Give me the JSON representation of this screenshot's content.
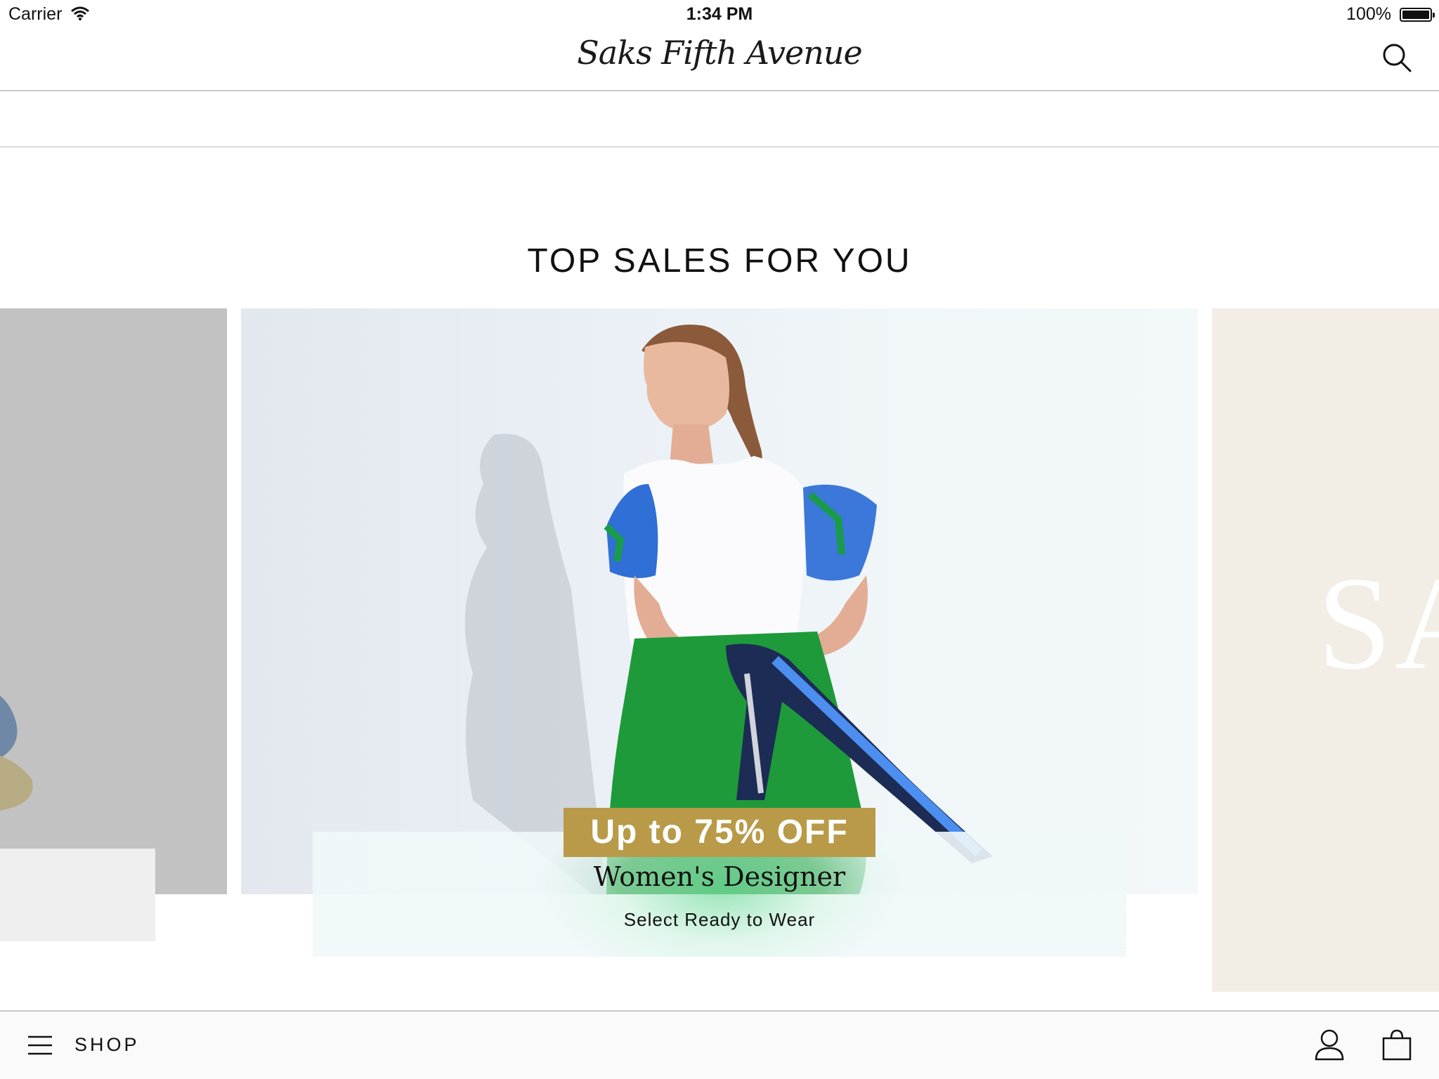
{
  "status_bar": {
    "carrier": "Carrier",
    "time": "1:34 PM",
    "battery": "100%"
  },
  "header": {
    "logo_text": "Saks Fifth Avenue",
    "search_icon": "search-icon"
  },
  "section": {
    "title": "TOP SALES FOR YOU"
  },
  "carousel": {
    "right_card_text": "SA",
    "main_card": {
      "badge": "Up to 75% OFF",
      "title": "Women's Designer",
      "subtitle": "Select Ready to Wear",
      "badge_color": "#b89a48"
    }
  },
  "bottom_bar": {
    "menu_icon": "hamburger-menu-icon",
    "shop_label": "SHOP",
    "account_icon": "account-icon",
    "bag_icon": "shopping-bag-icon"
  }
}
